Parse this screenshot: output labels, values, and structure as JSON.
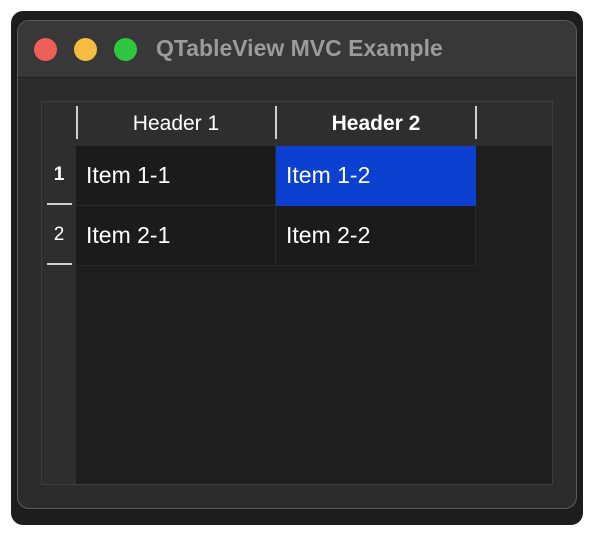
{
  "window": {
    "title": "QTableView MVC Example"
  },
  "table": {
    "column_headers": [
      "Header 1",
      "Header 2"
    ],
    "row_headers": [
      "1",
      "2"
    ],
    "rows": [
      [
        "Item 1-1",
        "Item 1-2"
      ],
      [
        "Item 2-1",
        "Item 2-2"
      ]
    ],
    "selected_cell": "Item 1-2",
    "selection_color": "#0b40d0"
  },
  "colors": {
    "close": "#ee5f57",
    "minimize": "#f6bc3f",
    "maximize": "#2fc640"
  }
}
